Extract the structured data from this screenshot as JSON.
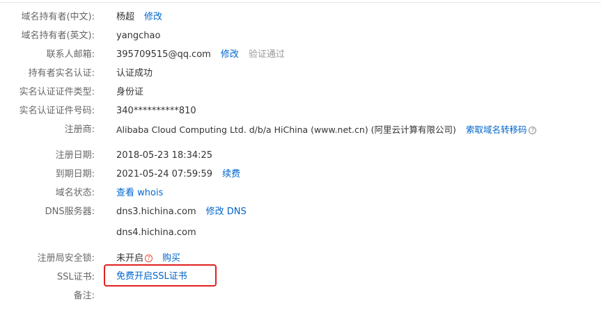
{
  "fields": {
    "owner_cn": {
      "label": "域名持有者(中文):",
      "value": "杨超",
      "action": "修改"
    },
    "owner_en": {
      "label": "域名持有者(英文):",
      "value": "yangchao"
    },
    "email": {
      "label": "联系人邮箱:",
      "value": "395709515@qq.com",
      "action": "修改",
      "status": "验证通过"
    },
    "realname": {
      "label": "持有者实名认证:",
      "value": "认证成功"
    },
    "id_type": {
      "label": "实名认证证件类型:",
      "value": "身份证"
    },
    "id_number": {
      "label": "实名认证证件号码:",
      "value": "340**********810"
    },
    "registrar": {
      "label": "注册商:",
      "value": "Alibaba Cloud Computing Ltd. d/b/a HiChina (www.net.cn) (阿里云计算有限公司)",
      "action": "索取域名转移码"
    },
    "reg_date": {
      "label": "注册日期:",
      "value": "2018-05-23 18:34:25"
    },
    "exp_date": {
      "label": "到期日期:",
      "value": "2021-05-24 07:59:59",
      "action": "续费"
    },
    "status": {
      "label": "域名状态:",
      "action": "查看 whois"
    },
    "dns": {
      "label": "DNS服务器:",
      "value1": "dns3.hichina.com",
      "action": "修改 DNS",
      "value2": "dns4.hichina.com"
    },
    "lock": {
      "label": "注册局安全锁:",
      "value": "未开启",
      "action": "购买"
    },
    "ssl": {
      "label": "SSL证书:",
      "action": "免费开启SSL证书"
    },
    "remark": {
      "label": "备注:"
    }
  },
  "icons": {
    "help": "question-circle-icon",
    "warning": "question-circle-red-icon"
  },
  "colors": {
    "link": "#0066cc",
    "highlight": "#e02020",
    "muted": "#999999"
  }
}
